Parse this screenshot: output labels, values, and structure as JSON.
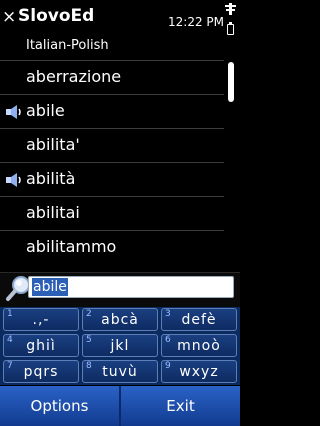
{
  "titlebar": {
    "close_glyph": "×",
    "title": "SlovoEd",
    "time": "12:22 PM"
  },
  "dictionary": {
    "name": "Italian-Polish"
  },
  "words": [
    {
      "text": "aberrazione",
      "audio": false
    },
    {
      "text": "abile",
      "audio": true
    },
    {
      "text": "abilita'",
      "audio": false
    },
    {
      "text": "abilità",
      "audio": true
    },
    {
      "text": "abilitai",
      "audio": false
    },
    {
      "text": "abilitammo",
      "audio": false
    }
  ],
  "search": {
    "value": "abile"
  },
  "keypad": {
    "keys": [
      {
        "num": "1",
        "letters": ".,-"
      },
      {
        "num": "2",
        "letters": "abcà"
      },
      {
        "num": "3",
        "letters": "defè"
      },
      {
        "num": "4",
        "letters": "ghiì"
      },
      {
        "num": "5",
        "letters": "jkl"
      },
      {
        "num": "6",
        "letters": "mnoò"
      },
      {
        "num": "7",
        "letters": "pqrs"
      },
      {
        "num": "8",
        "letters": "tuvù"
      },
      {
        "num": "9",
        "letters": "wxyz"
      }
    ]
  },
  "softkeys": {
    "left": "Options",
    "right": "Exit"
  },
  "icons": {
    "speaker": "speaker-icon",
    "search": "magnifier-icon",
    "signal": "signal-icon",
    "battery": "battery-icon"
  },
  "colors": {
    "highlight": "#2c5fb6",
    "keypad_bg": "#0b2a60",
    "softkey_bg": "#2a63c7"
  }
}
